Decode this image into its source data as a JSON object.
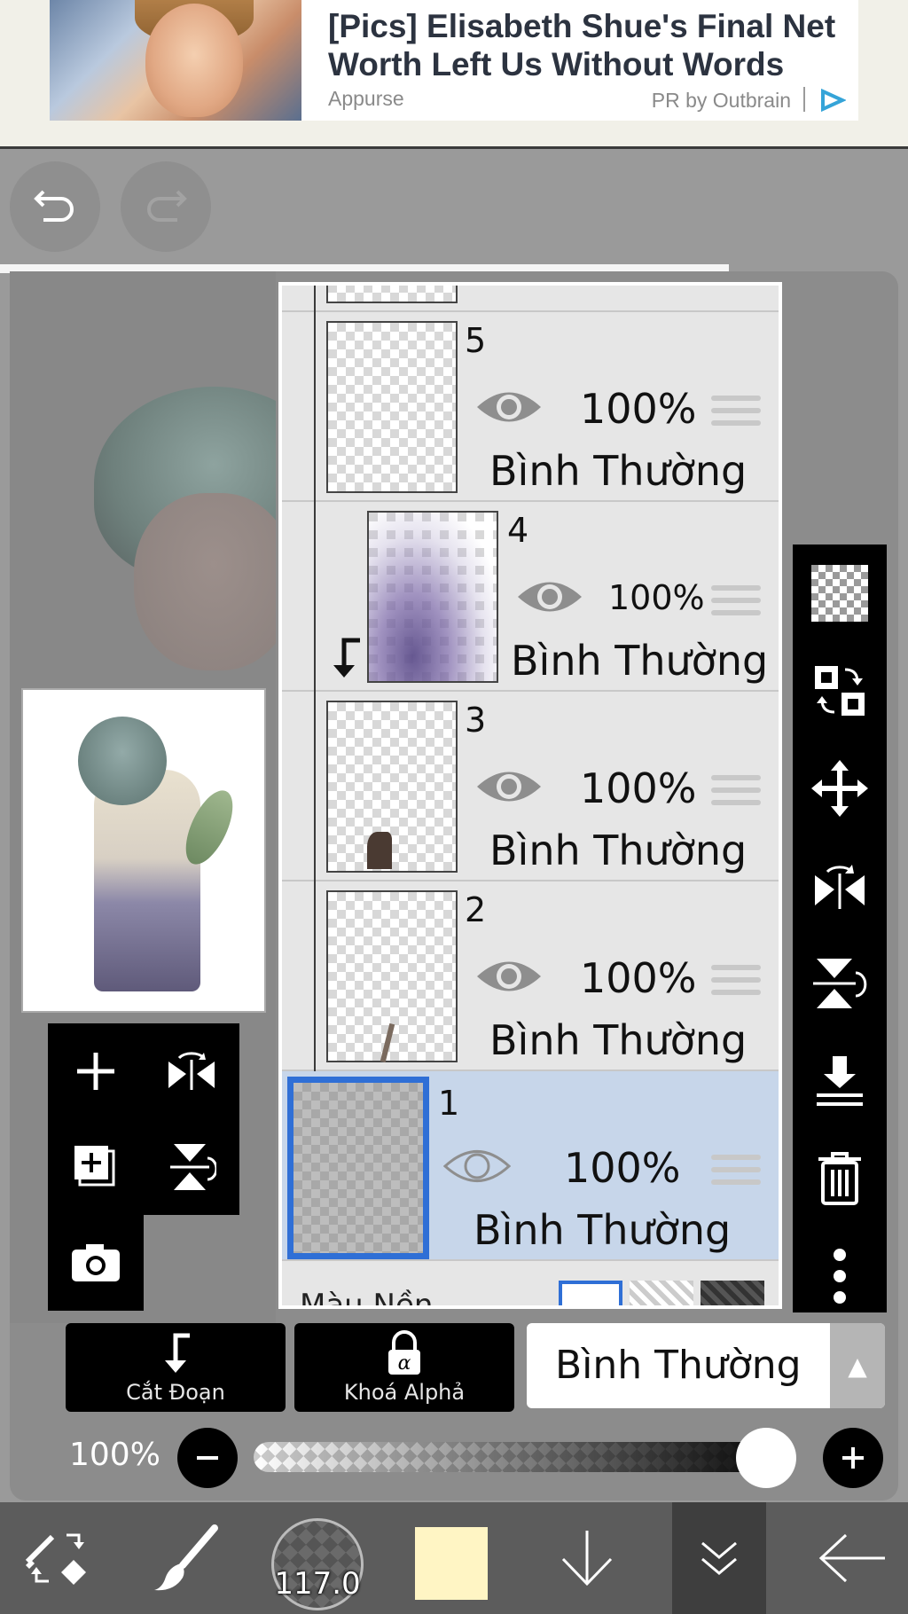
{
  "ad": {
    "title": "[Pics] Elisabeth Shue's Final Net Worth Left Us Without Words",
    "source": "Appurse",
    "sponsor": "PR by Outbrain"
  },
  "icons": {
    "undo": "undo-icon",
    "redo": "redo-icon",
    "add_layer": "plus-icon",
    "flip_h": "flip-horizontal-icon",
    "duplicate": "duplicate-layer-icon",
    "flip_v": "flip-vertical-icon",
    "camera": "camera-icon",
    "transparency": "checker-icon",
    "transform": "transform-icon",
    "move": "move-icon",
    "merge_down": "merge-down-icon",
    "delete": "trash-icon",
    "more": "more-vertical-icon",
    "eye": "eye-icon"
  },
  "layers": [
    {
      "num": "5",
      "opacity": "100%",
      "blend": "Bình Thường"
    },
    {
      "num": "4",
      "opacity": "100%",
      "blend": "Bình Thường"
    },
    {
      "num": "3",
      "opacity": "100%",
      "blend": "Bình Thường"
    },
    {
      "num": "2",
      "opacity": "100%",
      "blend": "Bình Thường"
    },
    {
      "num": "1",
      "opacity": "100%",
      "blend": "Bình Thường"
    }
  ],
  "selected_layer": "1",
  "background_label": "Màu Nền",
  "controls": {
    "clip_label": "Cắt Đoạn",
    "alpha_lock_label": "Khoá Alphả",
    "blend_mode": "Bình Thường",
    "opacity_label": "100%",
    "opacity_value": 100
  },
  "bottom_bar": {
    "brush_size": "117.0",
    "current_color": "#fff5c4"
  },
  "colors": {
    "selected_layer_bg": "#c7d6ea",
    "selected_border": "#2f6fd6"
  }
}
